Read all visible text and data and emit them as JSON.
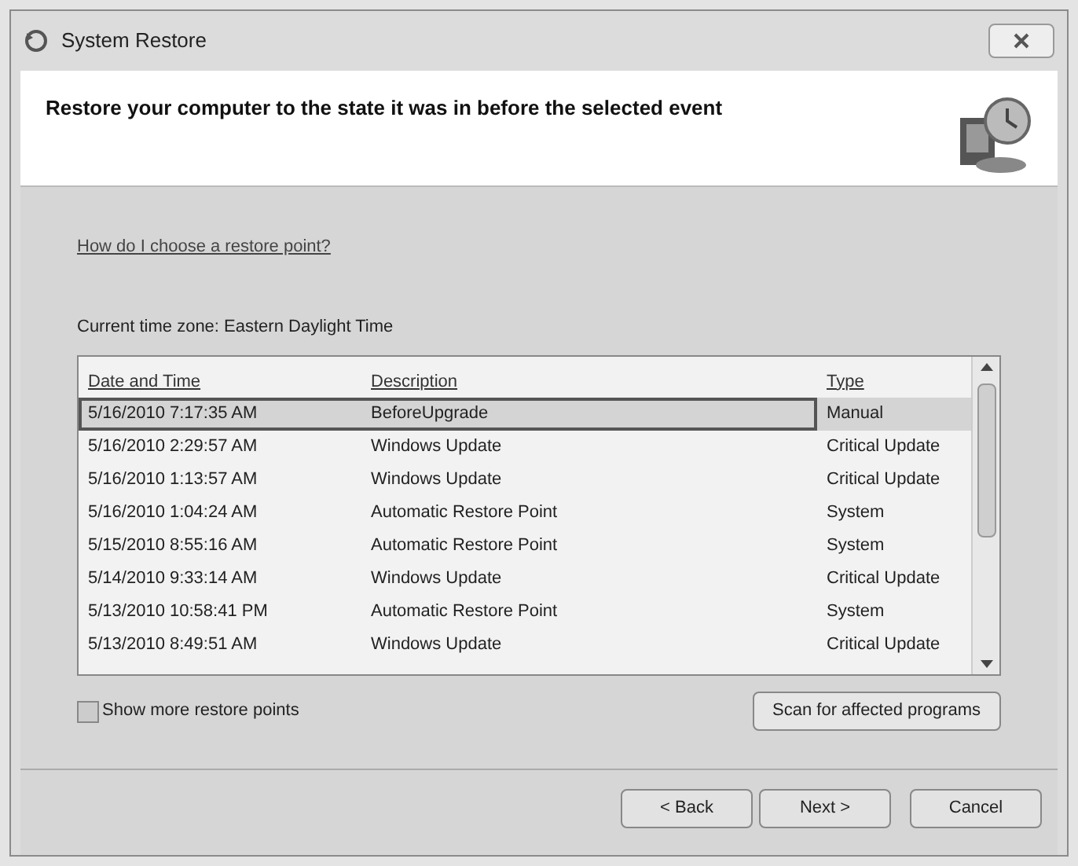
{
  "window": {
    "title": "System Restore"
  },
  "header": {
    "heading": "Restore your computer to the state it was in before the selected event"
  },
  "help_link": "How do I choose a restore point?",
  "time_zone": "Current time zone: Eastern Daylight Time",
  "table": {
    "columns": [
      "Date and Time",
      "Description",
      "Type"
    ],
    "rows": [
      {
        "date": "5/16/2010 7:17:35 AM",
        "description": "BeforeUpgrade",
        "type": "Manual",
        "selected": true
      },
      {
        "date": "5/16/2010 2:29:57 AM",
        "description": "Windows Update",
        "type": "Critical Update",
        "selected": false
      },
      {
        "date": "5/16/2010 1:13:57 AM",
        "description": "Windows Update",
        "type": "Critical Update",
        "selected": false
      },
      {
        "date": "5/16/2010 1:04:24 AM",
        "description": "Automatic Restore Point",
        "type": "System",
        "selected": false
      },
      {
        "date": "5/15/2010 8:55:16 AM",
        "description": "Automatic Restore Point",
        "type": "System",
        "selected": false
      },
      {
        "date": "5/14/2010 9:33:14 AM",
        "description": "Windows Update",
        "type": "Critical Update",
        "selected": false
      },
      {
        "date": "5/13/2010 10:58:41 PM",
        "description": "Automatic Restore Point",
        "type": "System",
        "selected": false
      },
      {
        "date": "5/13/2010 8:49:51 AM",
        "description": "Windows Update",
        "type": "Critical Update",
        "selected": false
      }
    ]
  },
  "show_more": {
    "label": "Show more restore points",
    "checked": false
  },
  "scan_button": "Scan for affected programs",
  "buttons": [
    "< Back",
    "Next >",
    "Cancel"
  ]
}
